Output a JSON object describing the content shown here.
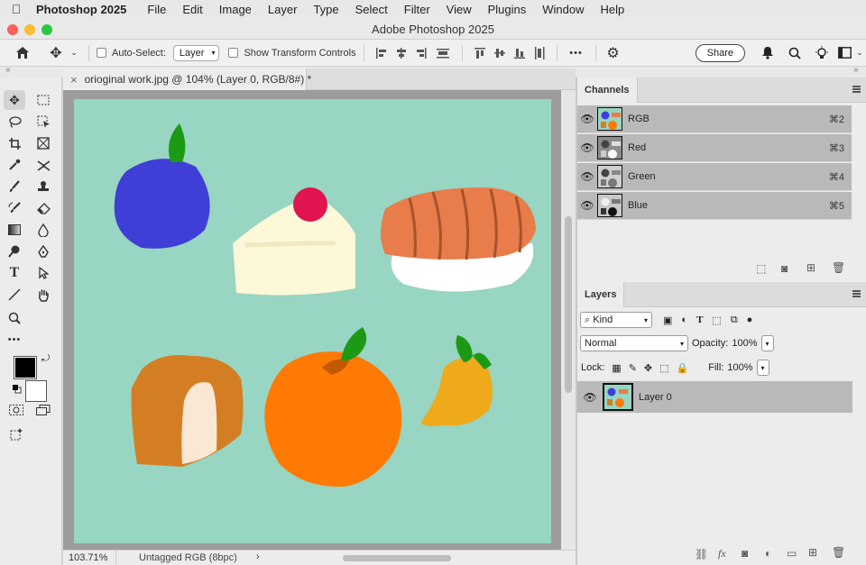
{
  "menubar": {
    "app_name": "Photoshop 2025",
    "items": [
      "File",
      "Edit",
      "Image",
      "Layer",
      "Type",
      "Select",
      "Filter",
      "View",
      "Plugins",
      "Window",
      "Help"
    ]
  },
  "window": {
    "title": "Adobe Photoshop 2025"
  },
  "options_bar": {
    "auto_select_label": "Auto-Select:",
    "auto_select_value": "Layer",
    "show_transform_label": "Show Transform Controls",
    "more_label": "•••",
    "share_label": "Share"
  },
  "document": {
    "tab_label": "orioginal work.jpg @ 104% (Layer 0, RGB/8#) *",
    "close_glyph": "×"
  },
  "status_bar": {
    "zoom": "103.71%",
    "profile": "Untagged RGB (8bpc)",
    "arrow": "›"
  },
  "channels_panel": {
    "tab_label": "Channels",
    "channels": [
      {
        "name": "RGB",
        "shortcut": "⌘2"
      },
      {
        "name": "Red",
        "shortcut": "⌘3"
      },
      {
        "name": "Green",
        "shortcut": "⌘4"
      },
      {
        "name": "Blue",
        "shortcut": "⌘5"
      }
    ]
  },
  "layers_panel": {
    "tab_label": "Layers",
    "kind_label": "Kind",
    "blend_mode": "Normal",
    "opacity_label": "Opacity:",
    "opacity_value": "100%",
    "lock_label": "Lock:",
    "fill_label": "Fill:",
    "fill_value": "100%",
    "layers": [
      {
        "name": "Layer 0"
      }
    ]
  },
  "colors": {
    "artboard_bg": "#98d5c2",
    "foreground": "#000000",
    "background": "#ffffff",
    "plum": "#3f3ed6",
    "cherry": "#e0144e",
    "orange": "#ff7a05",
    "sushi_fish": "#e87c4a",
    "leaf": "#1d9a15"
  },
  "icons": {
    "eye": "eye-icon",
    "toolbar": [
      "move-tool-icon",
      "marquee-tool-icon",
      "lasso-tool-icon",
      "object-select-icon",
      "crop-tool-icon",
      "frame-tool-icon",
      "eyedropper-icon",
      "healing-icon",
      "brush-icon",
      "stamp-icon",
      "history-brush-icon",
      "eraser-icon",
      "gradient-icon",
      "blur-icon",
      "dodge-icon",
      "pen-icon",
      "type-icon",
      "path-select-icon",
      "line-icon",
      "hand-icon",
      "zoom-icon"
    ]
  }
}
